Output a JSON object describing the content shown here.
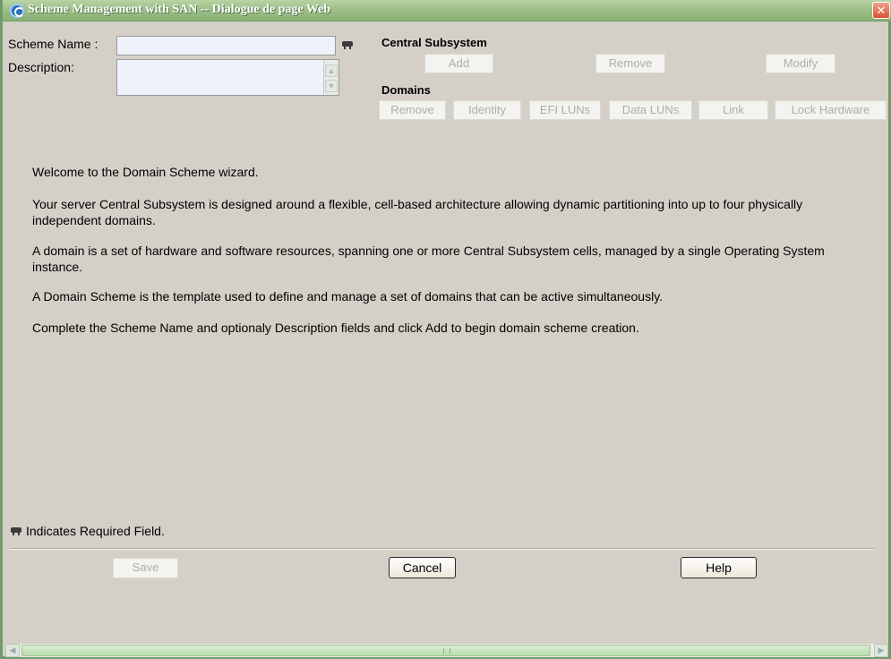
{
  "window": {
    "title": "Scheme Management with SAN -- Dialogue de page Web",
    "close_symbol": "✕"
  },
  "form": {
    "scheme_name_label": "Scheme Name :",
    "scheme_name_value": "",
    "description_label": "Description:",
    "description_value": ""
  },
  "central_subsystem": {
    "heading": "Central Subsystem",
    "add": "Add",
    "remove": "Remove",
    "modify": "Modify"
  },
  "domains": {
    "heading": "Domains",
    "remove": "Remove",
    "identity": "Identity",
    "efi_luns": "EFI LUNs",
    "data_luns": "Data LUNs",
    "link": "Link",
    "lock_hardware": "Lock Hardware"
  },
  "content": {
    "p1": "Welcome to the Domain Scheme wizard.",
    "p2": "Your server Central Subsystem is designed around a flexible, cell-based architecture allowing dynamic partitioning into up to four physically independent domains.",
    "p3": "A domain is a set of hardware and software resources, spanning one or more Central Subsystem cells, managed by a single Operating System instance.",
    "p4": "A Domain Scheme is the template used to define and manage a set of domains that can be active simultaneously.",
    "p5": "Complete the Scheme Name and optionaly Description fields and click Add to begin domain scheme creation."
  },
  "footer": {
    "required_note": "Indicates Required Field.",
    "save": "Save",
    "cancel": "Cancel",
    "help": "Help"
  },
  "icons": {
    "required_field": "required-field-icon",
    "window": "ie-page-icon"
  },
  "colors": {
    "titlebar": "#9ec08a",
    "dialog_bg": "#d4d0c8",
    "input_bg": "#f0f2fb",
    "close_button": "#d8532f"
  }
}
